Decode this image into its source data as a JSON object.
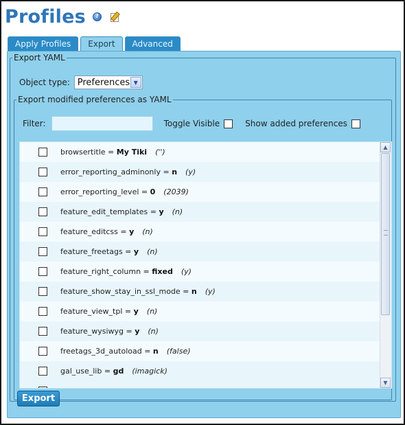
{
  "header": {
    "title": "Profiles",
    "help_icon": "help-icon",
    "edit_icon": "edit-icon"
  },
  "tabs": [
    {
      "label": "Apply Profiles",
      "active": false
    },
    {
      "label": "Export",
      "active": true
    },
    {
      "label": "Advanced",
      "active": false
    }
  ],
  "export_yaml": {
    "legend": "Export YAML",
    "object_type_label": "Object type:",
    "object_type_value": "Preferences",
    "modified_legend": "Export modified preferences as YAML",
    "filter_label": "Filter:",
    "filter_value": "",
    "toggle_visible_label": "Toggle Visible",
    "show_added_label": "Show added preferences",
    "preferences": [
      {
        "name": "browsertitle",
        "value": "My Tiki",
        "default": "('')"
      },
      {
        "name": "error_reporting_adminonly",
        "value": "n",
        "default": "(y)"
      },
      {
        "name": "error_reporting_level",
        "value": "0",
        "default": "(2039)"
      },
      {
        "name": "feature_edit_templates",
        "value": "y",
        "default": "(n)"
      },
      {
        "name": "feature_editcss",
        "value": "y",
        "default": "(n)"
      },
      {
        "name": "feature_freetags",
        "value": "y",
        "default": "(n)"
      },
      {
        "name": "feature_right_column",
        "value": "fixed",
        "default": "(y)"
      },
      {
        "name": "feature_show_stay_in_ssl_mode",
        "value": "n",
        "default": "(y)"
      },
      {
        "name": "feature_view_tpl",
        "value": "y",
        "default": "(n)"
      },
      {
        "name": "feature_wysiwyg",
        "value": "y",
        "default": "(n)"
      },
      {
        "name": "freetags_3d_autoload",
        "value": "n",
        "default": "(false)"
      },
      {
        "name": "gal_use_lib",
        "value": "gd",
        "default": "(imagick)"
      }
    ],
    "export_button_label": "Export"
  },
  "colors": {
    "title": "#2f76b8",
    "tab_inactive": "#2a8bc7",
    "tab_active": "#8fd0ec",
    "panel": "#8fd0ec",
    "button": "#1e7cb7"
  }
}
